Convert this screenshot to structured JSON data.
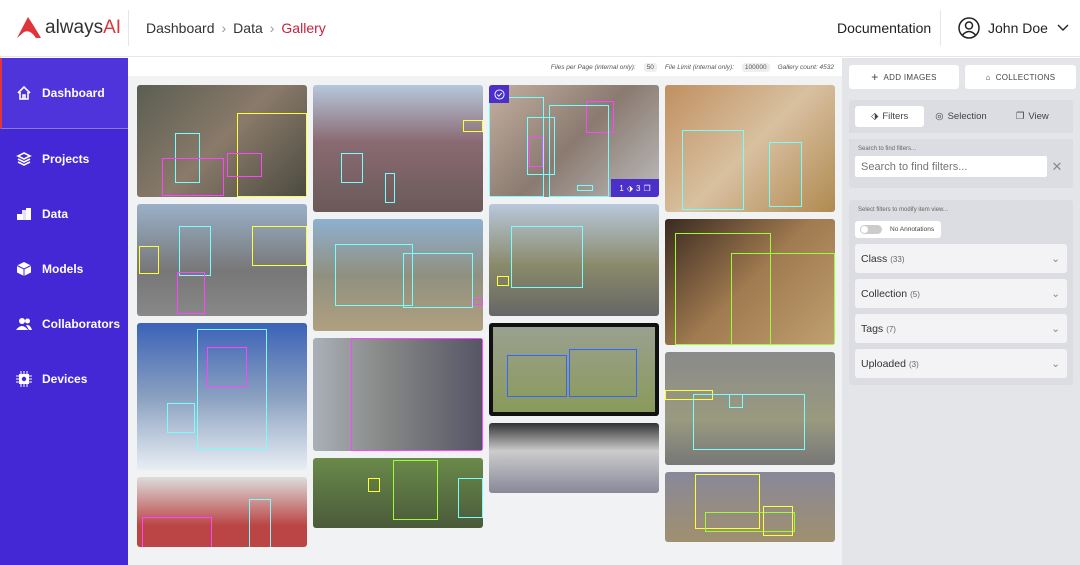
{
  "header": {
    "logo": "alwaysAI",
    "breadcrumbs": [
      "Dashboard",
      "Data",
      "Gallery"
    ],
    "documentation": "Documentation",
    "user": "John Doe"
  },
  "sidebar": {
    "items": [
      {
        "label": "Dashboard",
        "icon": "home-icon"
      },
      {
        "label": "Projects",
        "icon": "layers-icon"
      },
      {
        "label": "Data",
        "icon": "boxes-icon"
      },
      {
        "label": "Models",
        "icon": "cube-icon"
      },
      {
        "label": "Collaborators",
        "icon": "users-icon"
      },
      {
        "label": "Devices",
        "icon": "chip-icon"
      }
    ]
  },
  "gallery": {
    "files_per_page_label": "Files per Page (internal only):",
    "files_per_page": "50",
    "file_limit_label": "File Limit (internal only):",
    "file_limit": "100000",
    "gallery_count": "Gallery count: 4532",
    "badge_annotations": "1",
    "badge_tags": "3"
  },
  "right": {
    "add_images": "ADD IMAGES",
    "collections": "COLLECTIONS",
    "tabs": [
      "Filters",
      "Selection",
      "View"
    ],
    "search_label": "Search to find filters...",
    "search_placeholder": "Search to find filters...",
    "select_label": "Select filters to modify item view...",
    "no_annotations": "No Annotations",
    "filters": [
      {
        "name": "Class",
        "count": "(33)"
      },
      {
        "name": "Collection",
        "count": "(5)"
      },
      {
        "name": "Tags",
        "count": "(7)"
      },
      {
        "name": "Uploaded",
        "count": "(3)"
      }
    ]
  }
}
